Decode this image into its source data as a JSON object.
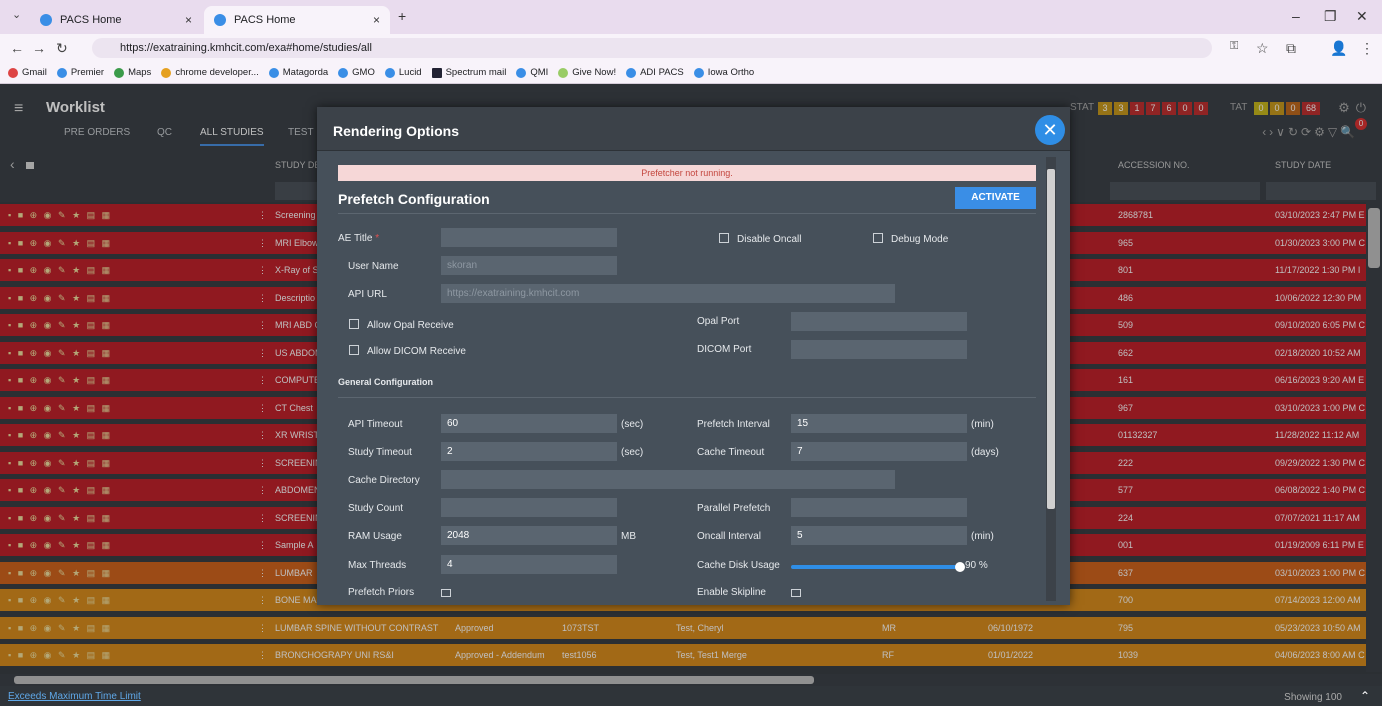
{
  "browser": {
    "tabs": [
      {
        "title": "PACS Home"
      },
      {
        "title": "PACS Home"
      }
    ],
    "url": "https://exatraining.kmhcit.com/exa#home/studies/all",
    "bookmarks": [
      "Gmail",
      "Premier",
      "Maps",
      "chrome developer...",
      "Matagorda",
      "GMO",
      "Lucid",
      "Spectrum mail",
      "QMI",
      "Give Now!",
      "ADI PACS",
      "Iowa Ortho"
    ]
  },
  "app": {
    "title": "Worklist",
    "nav_tabs": [
      "PRE ORDERS",
      "QC",
      "ALL STUDIES",
      "TEST"
    ],
    "stat_label": "STAT",
    "stat_values": [
      "3",
      "3",
      "1",
      "7",
      "6",
      "0",
      "0"
    ],
    "tat_label": "TAT",
    "tat_values": [
      "0",
      "0",
      "0",
      "68"
    ],
    "notification_count": "0"
  },
  "table": {
    "headers": [
      "STUDY DE",
      "ACCESSION NO.",
      "STUDY DATE"
    ],
    "rows": [
      {
        "color": "#c0222b",
        "desc": "Screening",
        "acc": "2868781",
        "date": "03/10/2023 2:47 PM E"
      },
      {
        "color": "#c0222b",
        "desc": "MRI Elbow",
        "acc": "965",
        "date": "01/30/2023 3:00 PM C"
      },
      {
        "color": "#c0222b",
        "desc": "X-Ray of S",
        "acc": "801",
        "date": "11/17/2022 1:30 PM I"
      },
      {
        "color": "#c0222b",
        "desc": "Descriptio",
        "acc": "486",
        "date": "10/06/2022 12:30 PM"
      },
      {
        "color": "#c0222b",
        "desc": "MRI ABD C",
        "acc": "509",
        "date": "09/10/2020 6:05 PM C"
      },
      {
        "color": "#c0222b",
        "desc": "US ABDOM",
        "acc": "662",
        "date": "02/18/2020 10:52 AM"
      },
      {
        "color": "#c0222b",
        "desc": "COMPUTE",
        "acc": "161",
        "date": "06/16/2023 9:20 AM E"
      },
      {
        "color": "#c0222b",
        "desc": "CT Chest",
        "acc": "967",
        "date": "03/10/2023 1:00 PM C"
      },
      {
        "color": "#c0222b",
        "desc": "XR WRIST",
        "acc": "01132327",
        "date": "11/28/2022 11:12 AM"
      },
      {
        "color": "#c0222b",
        "desc": "SCREENIN",
        "acc": "222",
        "date": "09/29/2022 1:30 PM C"
      },
      {
        "color": "#c0222b",
        "desc": "ABDOMEN",
        "acc": "577",
        "date": "06/08/2022 1:40 PM C"
      },
      {
        "color": "#c0222b",
        "desc": "SCREENIN",
        "acc": "224",
        "date": "07/07/2021 11:17 AM"
      },
      {
        "color": "#c0222b",
        "desc": "Sample A",
        "acc": "001",
        "date": "01/19/2009 6:11 PM E"
      },
      {
        "color": "#d0641e",
        "desc": "LUMBAR",
        "acc": "637",
        "date": "03/10/2023 1:00 PM C"
      },
      {
        "color": "#d98c1e",
        "desc": "BONE MA",
        "acc": "700",
        "date": "07/14/2023 12:00 AM"
      },
      {
        "color": "#d98c1e",
        "desc": "LUMBAR SPINE WITHOUT CONTRAST",
        "status": "Approved",
        "id": "1073TST",
        "patient": "Test, Cheryl",
        "mod": "MR",
        "dob": "06/10/1972",
        "acc": "795",
        "date": "05/23/2023 10:50 AM"
      },
      {
        "color": "#d98c1e",
        "desc": "BRONCHOGRAPY UNI RS&I",
        "status": "Approved - Addendum",
        "id": "test1056",
        "patient": "Test, Test1 Merge",
        "mod": "RF",
        "dob": "01/01/2022",
        "acc": "1039",
        "date": "04/06/2023 8:00 AM C"
      }
    ]
  },
  "footer": {
    "left": "Exceeds Maximum Time Limit",
    "right": "Showing 100"
  },
  "modal": {
    "title": "Rendering Options",
    "warning": "Prefetcher not running.",
    "section1": "Prefetch Configuration",
    "activate": "ACTIVATE",
    "ae_title": "AE Title",
    "disable_oncall": "Disable Oncall",
    "debug_mode": "Debug Mode",
    "user_name": "User Name",
    "user_name_value": "skoran",
    "api_url": "API URL",
    "api_url_value": "https://exatraining.kmhcit.com",
    "allow_opal": "Allow Opal Receive",
    "opal_port": "Opal Port",
    "allow_dicom": "Allow DICOM Receive",
    "dicom_port": "DICOM Port",
    "section2": "General Configuration",
    "api_timeout": "API Timeout",
    "api_timeout_value": "60",
    "sec1": "(sec)",
    "prefetch_interval": "Prefetch Interval",
    "prefetch_interval_value": "15",
    "min1": "(min)",
    "study_timeout": "Study Timeout",
    "study_timeout_value": "2",
    "sec2": "(sec)",
    "cache_timeout": "Cache Timeout",
    "cache_timeout_value": "7",
    "days": "(days)",
    "cache_directory": "Cache Directory",
    "study_count": "Study Count",
    "parallel_prefetch": "Parallel Prefetch",
    "ram_usage": "RAM Usage",
    "ram_usage_value": "2048",
    "mb": "MB",
    "oncall_interval": "Oncall Interval",
    "oncall_interval_value": "5",
    "min2": "(min)",
    "max_threads": "Max Threads",
    "max_threads_value": "4",
    "cache_disk_usage": "Cache Disk Usage",
    "cache_disk_value": "90 %",
    "prefetch_priors": "Prefetch Priors",
    "enable_skipline": "Enable Skipline"
  }
}
